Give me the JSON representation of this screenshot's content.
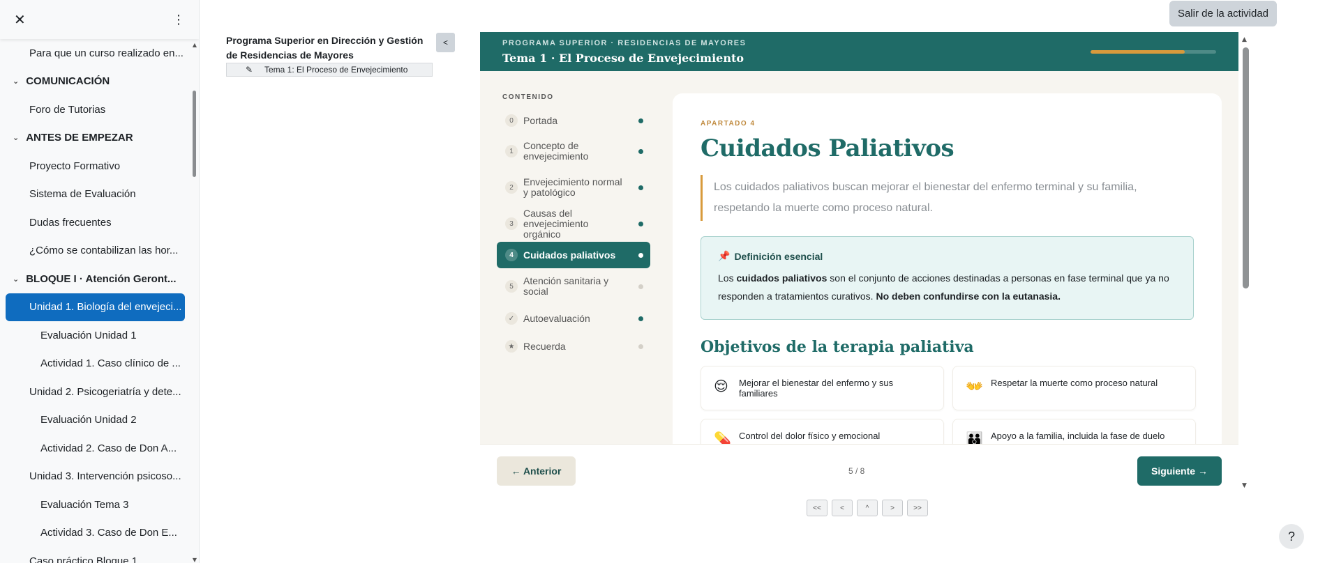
{
  "sidebar": {
    "items": [
      {
        "label": "Para que un curso realizado en...",
        "level": "l1"
      },
      {
        "label": "COMUNICACIÓN",
        "level": "section"
      },
      {
        "label": "Foro de Tutorias",
        "level": "l1"
      },
      {
        "label": "ANTES DE EMPEZAR",
        "level": "section"
      },
      {
        "label": "Proyecto Formativo",
        "level": "l1"
      },
      {
        "label": "Sistema de Evaluación",
        "level": "l1"
      },
      {
        "label": "Dudas frecuentes",
        "level": "l1"
      },
      {
        "label": "¿Cómo se contabilizan las hor...",
        "level": "l1"
      },
      {
        "label": "BLOQUE I · Atención Geront...",
        "level": "section"
      },
      {
        "label": "Unidad 1. Biología del envejeci...",
        "level": "l1",
        "active": true
      },
      {
        "label": "Evaluación Unidad 1",
        "level": "l2"
      },
      {
        "label": "Actividad 1. Caso clínico de ...",
        "level": "l2"
      },
      {
        "label": "Unidad 2. Psicogeriatría y dete...",
        "level": "l1"
      },
      {
        "label": "Evaluación Unidad 2",
        "level": "l2"
      },
      {
        "label": "Actividad 2. Caso de Don A...",
        "level": "l2"
      },
      {
        "label": "Unidad 3. Intervención psicoso...",
        "level": "l1"
      },
      {
        "label": "Evaluación Tema 3",
        "level": "l2"
      },
      {
        "label": "Actividad 3. Caso de Don E...",
        "level": "l2"
      },
      {
        "label": "Caso práctico Bloque 1",
        "level": "l1"
      }
    ]
  },
  "top": {
    "exit_label": "Salir de la actividad"
  },
  "course": {
    "title": "Programa Superior en Dirección y Gestión de Residencias de Mayores",
    "tema_label": "Tema 1: El Proceso de Envejecimiento",
    "collapse_label": "<"
  },
  "activity": {
    "overline": "PROGRAMA SUPERIOR · RESIDENCIAS DE MAYORES",
    "title": "Tema 1 · El Proceso de Envejecimiento",
    "progress": 0.75,
    "toc_heading": "CONTENIDO",
    "toc": [
      {
        "num": "0",
        "label": "Portada",
        "done": true
      },
      {
        "num": "1",
        "label": "Concepto de envejecimiento",
        "done": true
      },
      {
        "num": "2",
        "label": "Envejecimiento normal y patológico",
        "done": true
      },
      {
        "num": "3",
        "label": "Causas del envejecimiento orgánico",
        "done": true
      },
      {
        "num": "4",
        "label": "Cuidados paliativos",
        "done": true,
        "active": true
      },
      {
        "num": "5",
        "label": "Atención sanitaria y social",
        "done": false
      },
      {
        "num": "✓",
        "label": "Autoevaluación",
        "done": true
      },
      {
        "num": "★",
        "label": "Recuerda",
        "done": false
      }
    ],
    "eyebrow": "APARTADO 4",
    "heading": "Cuidados Paliativos",
    "lead": "Los cuidados paliativos buscan mejorar el bienestar del enfermo terminal y su familia, respetando la muerte como proceso natural.",
    "definition": {
      "icon": "pushpin-icon",
      "title": "Definición esencial",
      "text_pre": "Los ",
      "text_bold1": "cuidados paliativos",
      "text_mid": " son el conjunto de acciones destinadas a personas en fase terminal que ya no responden a tratamientos curativos. ",
      "text_bold2": "No deben confundirse con la eutanasia."
    },
    "objectives_heading": "Objetivos de la terapia paliativa",
    "objectives": [
      {
        "icon": "relieved-face-icon",
        "glyph": "😌",
        "label": "Mejorar el bienestar del enfermo y sus familiares"
      },
      {
        "icon": "open-hands-icon",
        "glyph": "👐",
        "label": "Respetar la muerte como proceso natural"
      },
      {
        "icon": "pill-icon",
        "glyph": "💊",
        "label": "Control del dolor físico y emocional"
      },
      {
        "icon": "family-icon",
        "glyph": "👪",
        "label": "Apoyo a la familia, incluida la fase de duelo"
      }
    ],
    "prev_label": "← Anterior",
    "page_indicator": "5 / 8",
    "next_label": "Siguiente →"
  },
  "scorm_nav": [
    "<<",
    "<",
    "^",
    ">",
    ">>"
  ],
  "help_label": "?"
}
